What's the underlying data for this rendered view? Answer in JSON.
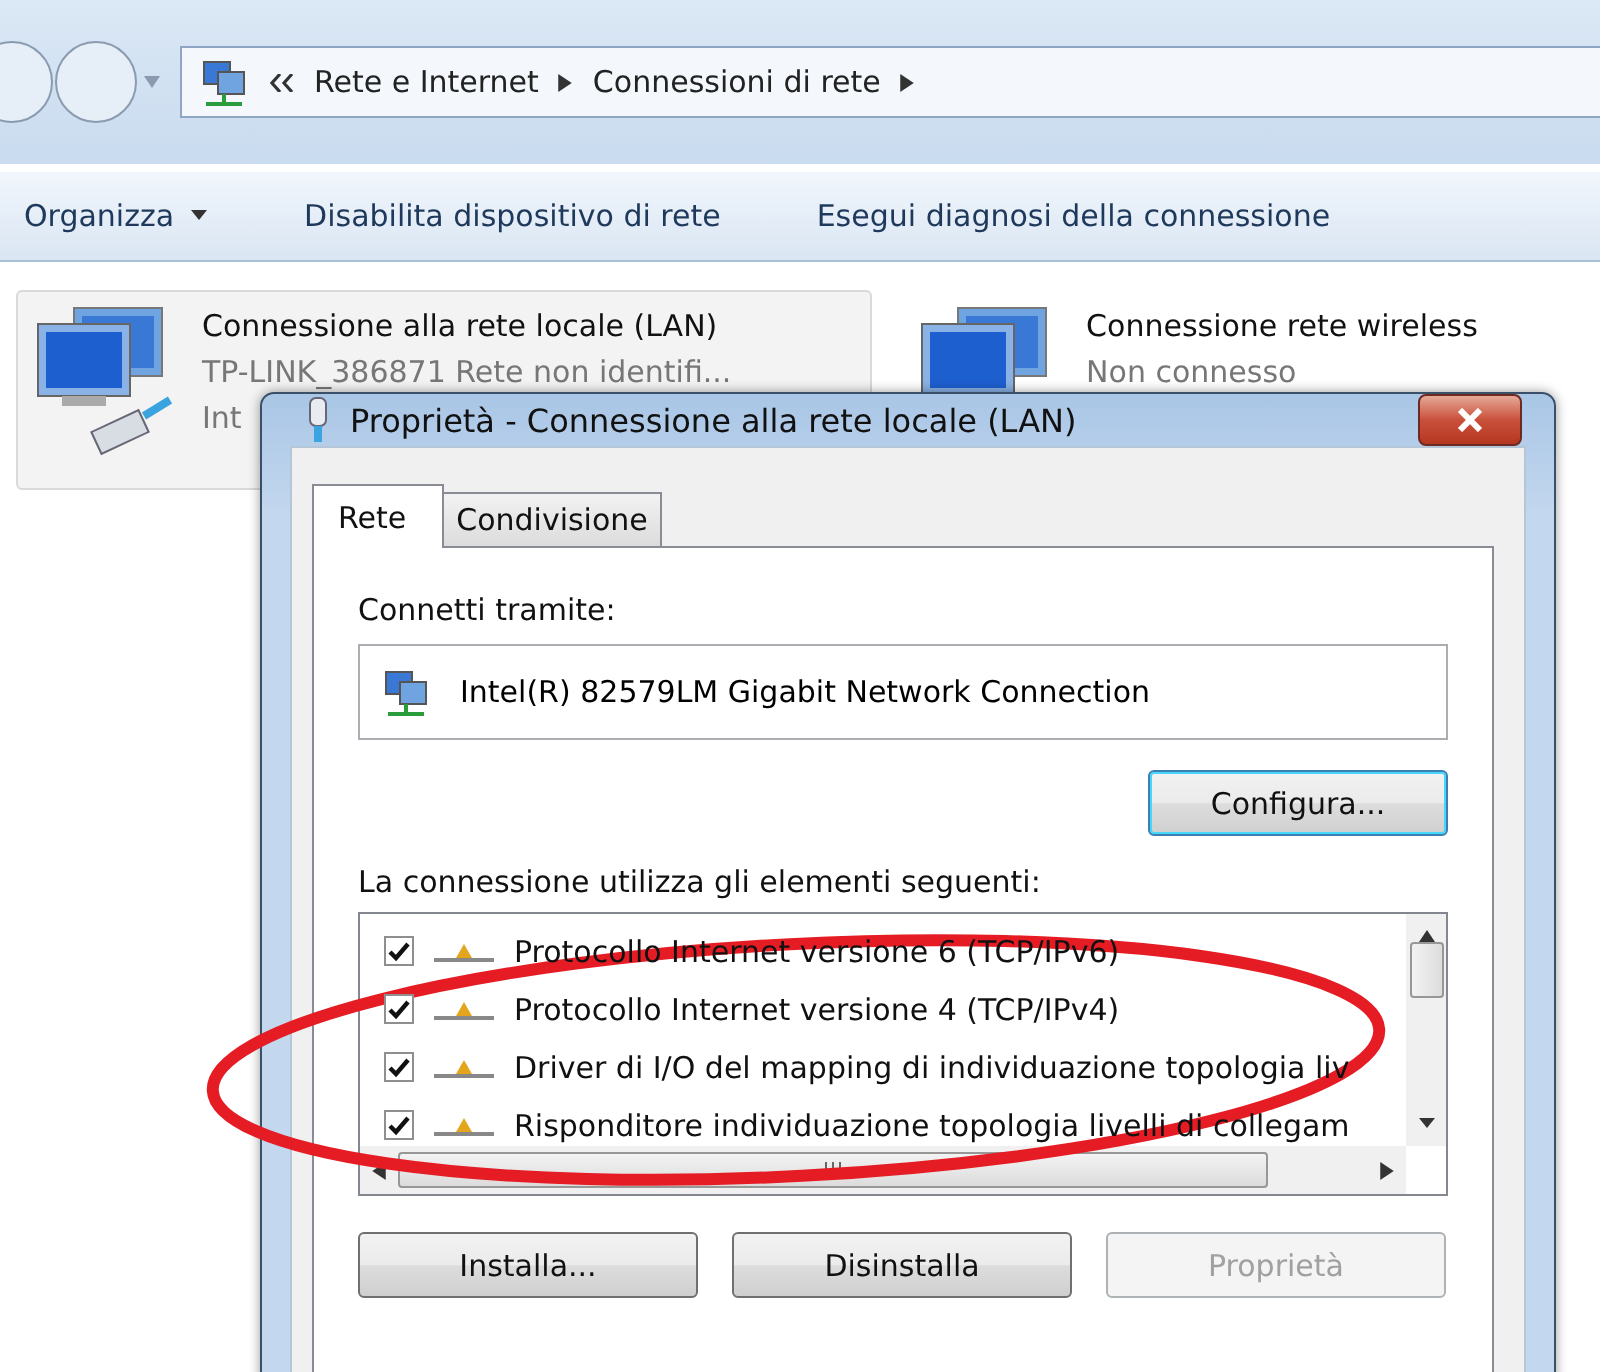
{
  "explorer": {
    "breadcrumb": [
      "Rete e Internet",
      "Connessioni di rete"
    ],
    "toolbar": [
      {
        "label": "Organizza",
        "kind": "menu"
      },
      {
        "label": "Disabilita dispositivo di rete",
        "kind": "action"
      },
      {
        "label": "Esegui diagnosi della connessione",
        "kind": "action"
      }
    ],
    "connections": [
      {
        "name": "Connessione alla rete locale (LAN)",
        "status": "TP-LINK_386871 Rete non identifi...",
        "device": "Int",
        "selected": true
      },
      {
        "name": "Connessione rete wireless",
        "status": "Non connesso",
        "selected": false
      }
    ]
  },
  "dialog": {
    "title": "Proprietà - Connessione alla rete locale (LAN)",
    "tabs": [
      {
        "label": "Rete",
        "selected": true
      },
      {
        "label": "Condivisione",
        "selected": false
      }
    ],
    "connect_label": "Connetti tramite:",
    "adapter": "Intel(R) 82579LM Gigabit Network Connection",
    "configure_button": "Configura...",
    "items_label": "La connessione utilizza gli elementi seguenti:",
    "items": [
      {
        "label": "Protocollo Internet versione 6 (TCP/IPv6)",
        "checked": true
      },
      {
        "label": "Protocollo Internet versione 4 (TCP/IPv4)",
        "checked": true
      },
      {
        "label": "Driver di I/O del mapping di individuazione topologia liv",
        "checked": true
      },
      {
        "label": "Risponditore individuazione topologia livelli di collegam",
        "checked": true
      }
    ],
    "buttons": [
      {
        "label": "Installa...",
        "disabled": false
      },
      {
        "label": "Disinstalla",
        "disabled": false
      },
      {
        "label": "Proprietà",
        "disabled": true
      }
    ]
  },
  "annotation": {
    "kind": "ellipse"
  }
}
